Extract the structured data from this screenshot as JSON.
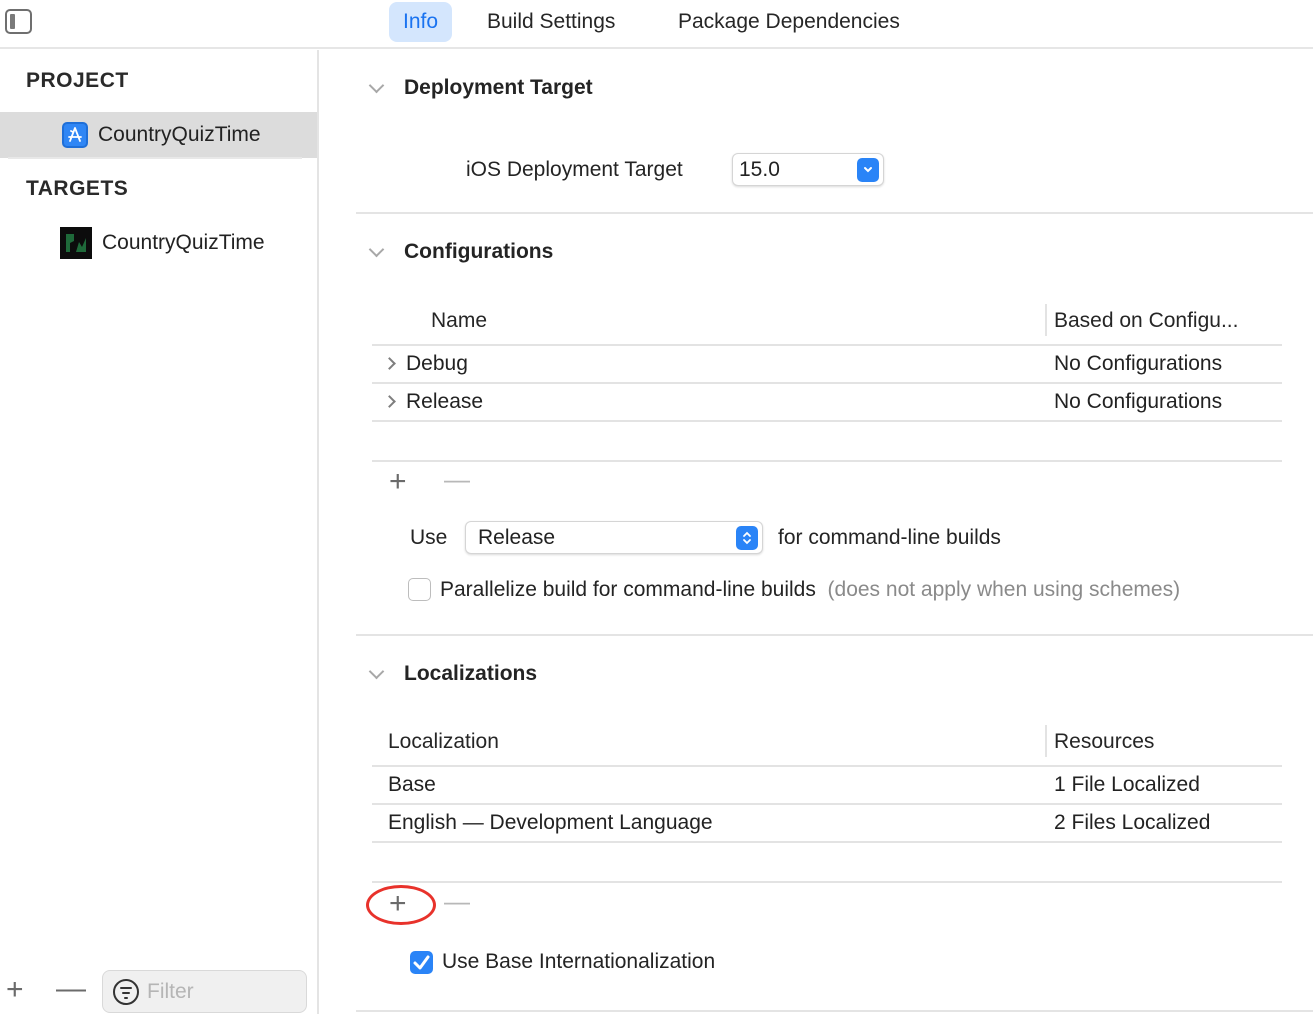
{
  "topbar": {
    "sidebar_toggle_icon": "sidebar-left-icon",
    "tabs": [
      {
        "label": "Info",
        "active": true
      },
      {
        "label": "Build Settings",
        "active": false
      },
      {
        "label": "Package Dependencies",
        "active": false
      }
    ]
  },
  "sidebar": {
    "project_heading": "PROJECT",
    "project_item": {
      "label": "CountryQuizTime",
      "icon": "xcode-project-icon",
      "selected": true
    },
    "targets_heading": "TARGETS",
    "target_item": {
      "label": "CountryQuizTime",
      "icon": "app-target-icon",
      "selected": false
    },
    "add_icon": "plus-icon",
    "remove_icon": "minus-icon",
    "filter": {
      "placeholder": "Filter",
      "value": "",
      "icon": "filter-icon"
    }
  },
  "deployment": {
    "title": "Deployment Target",
    "field_label": "iOS Deployment Target",
    "value": "15.0"
  },
  "configurations": {
    "title": "Configurations",
    "columns": [
      "Name",
      "Based on Configu..."
    ],
    "rows": [
      {
        "name": "Debug",
        "based_on": "No Configurations"
      },
      {
        "name": "Release",
        "based_on": "No Configurations"
      }
    ],
    "add_icon": "plus-icon",
    "remove_icon": "minus-icon",
    "use_label": "Use",
    "use_value": "Release",
    "use_suffix": "for command-line builds",
    "parallelize_label": "Parallelize build for command-line builds",
    "parallelize_hint": "(does not apply when using schemes)",
    "parallelize_checked": false
  },
  "localizations": {
    "title": "Localizations",
    "columns": [
      "Localization",
      "Resources"
    ],
    "rows": [
      {
        "localization": "Base",
        "resources": "1 File Localized"
      },
      {
        "localization": "English — Development Language",
        "resources": "2 Files Localized"
      }
    ],
    "add_icon": "plus-icon",
    "remove_icon": "minus-icon",
    "base_intl_label": "Use Base Internationalization",
    "base_intl_checked": true
  },
  "colors": {
    "accent": "#2a84f7",
    "tab_active_bg": "#d4e6fd",
    "highlight_ring": "#e8322b"
  }
}
